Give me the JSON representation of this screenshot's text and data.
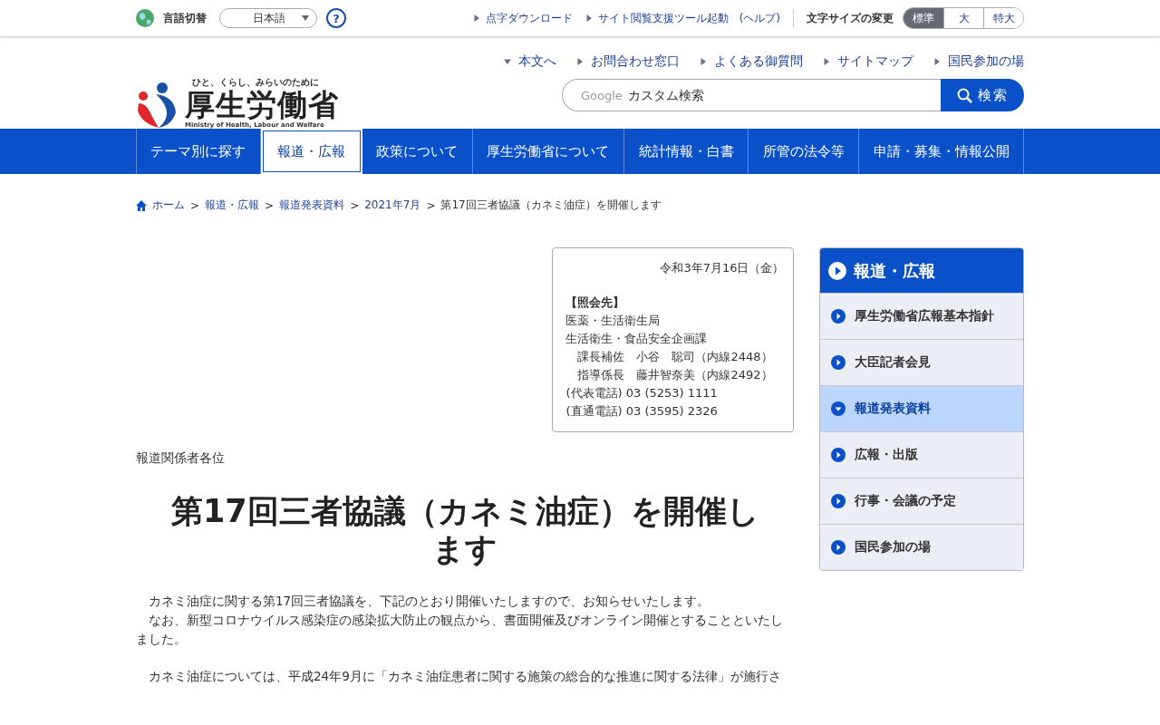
{
  "top_bar": {
    "language_label": "言語切替",
    "language_select": "日本語",
    "help": "?",
    "links": [
      "点字ダウンロード",
      "サイト閲覧支援ツール起動"
    ],
    "help_link": "(ヘルプ)",
    "font_size_label": "文字サイズの変更",
    "font_sizes": [
      {
        "label": "標準",
        "selected": true
      },
      {
        "label": "大",
        "selected": false
      },
      {
        "label": "特大",
        "selected": false
      }
    ]
  },
  "logo": {
    "tagline": "ひと、くらし、みらいのために",
    "name": "厚生労働省",
    "english": "Ministry of Health, Labour and Welfare"
  },
  "utility_links": [
    {
      "label": "本文へ",
      "kind": "down"
    },
    {
      "label": "お問合わせ窓口",
      "kind": "right"
    },
    {
      "label": "よくある御質問",
      "kind": "right"
    },
    {
      "label": "サイトマップ",
      "kind": "right"
    },
    {
      "label": "国民参加の場",
      "kind": "right"
    }
  ],
  "search": {
    "brand": "Google",
    "placeholder": "カスタム検索",
    "button": "検索"
  },
  "nav": [
    {
      "label": "テーマ別に探す",
      "selected": false
    },
    {
      "label": "報道・広報",
      "selected": true
    },
    {
      "label": "政策について",
      "selected": false
    },
    {
      "label": "厚生労働省について",
      "selected": false
    },
    {
      "label": "統計情報・白書",
      "selected": false
    },
    {
      "label": "所管の法令等",
      "selected": false
    },
    {
      "label": "申請・募集・情報公開",
      "selected": false
    }
  ],
  "breadcrumb": {
    "separator": ">",
    "links": [
      "ホーム",
      "報道・広報",
      "報道発表資料",
      "2021年7月"
    ],
    "current": "第17回三者協議（カネミ油症）を開催します"
  },
  "contact": {
    "date": "令和3年7月16日（金）",
    "heading": "【照会先】",
    "lines": [
      "医薬・生活衛生局",
      "生活衛生・食品安全企画課",
      "　課長補佐　小谷　聡司（内線2448）",
      "　指導係長　藤井智奈美（内線2492）",
      "(代表電話) 03 (5253) 1111",
      "(直通電話) 03 (3595) 2326"
    ]
  },
  "addressee": "報道関係者各位",
  "title": "第17回三者協議（カネミ油症）を開催します",
  "paragraphs": [
    [
      "　カネミ油症に関する第17回三者協議を、下記のとおり開催いたしますので、お知らせいたします。",
      "　なお、新型コロナウイルス感染症の感染拡大防止の観点から、書面開催及びオンライン開催とすることといたしました。"
    ],
    [
      "　カネミ油症については、平成24年9月に「カネミ油症患者に関する施策の総合的な推進に関する法律」が施行さ"
    ]
  ],
  "sidebar": {
    "heading": "報道・広報",
    "items": [
      {
        "label": "厚生労働省広報基本指針",
        "selected": false
      },
      {
        "label": "大臣記者会見",
        "selected": false
      },
      {
        "label": "報道発表資料",
        "selected": true
      },
      {
        "label": "広報・出版",
        "selected": false
      },
      {
        "label": "行事・会議の予定",
        "selected": false
      },
      {
        "label": "国民参加の場",
        "selected": false
      }
    ]
  }
}
